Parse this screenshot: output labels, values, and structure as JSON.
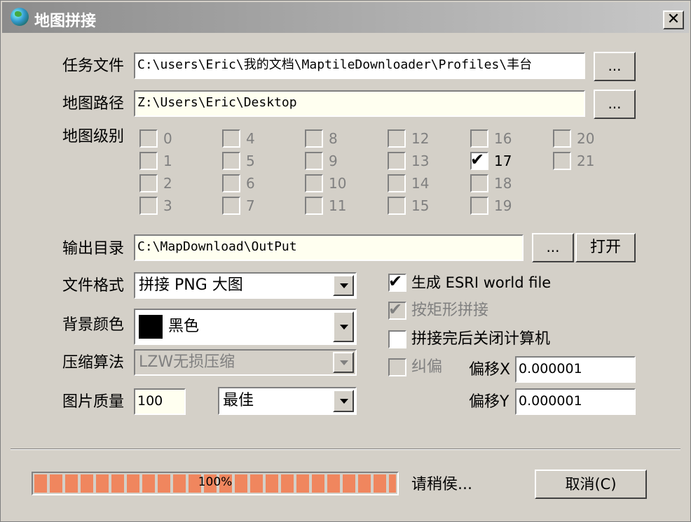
{
  "window": {
    "title": "地图拼接",
    "close_label": "✕"
  },
  "task_file": {
    "label": "任务文件",
    "value": "C:\\users\\Eric\\我的文档\\MaptileDownloader\\Profiles\\丰台",
    "browse_label": "..."
  },
  "map_path": {
    "label": "地图路径",
    "value": "Z:\\Users\\Eric\\Desktop",
    "browse_label": "..."
  },
  "levels": {
    "label": "地图级别",
    "items": [
      {
        "n": "0",
        "checked": false
      },
      {
        "n": "1",
        "checked": false
      },
      {
        "n": "2",
        "checked": false
      },
      {
        "n": "3",
        "checked": false
      },
      {
        "n": "4",
        "checked": false
      },
      {
        "n": "5",
        "checked": false
      },
      {
        "n": "6",
        "checked": false
      },
      {
        "n": "7",
        "checked": false
      },
      {
        "n": "8",
        "checked": false
      },
      {
        "n": "9",
        "checked": false
      },
      {
        "n": "10",
        "checked": false
      },
      {
        "n": "11",
        "checked": false
      },
      {
        "n": "12",
        "checked": false
      },
      {
        "n": "13",
        "checked": false
      },
      {
        "n": "14",
        "checked": false
      },
      {
        "n": "15",
        "checked": false
      },
      {
        "n": "16",
        "checked": false
      },
      {
        "n": "17",
        "checked": true
      },
      {
        "n": "18",
        "checked": false
      },
      {
        "n": "19",
        "checked": false
      },
      {
        "n": "20",
        "checked": false
      },
      {
        "n": "21",
        "checked": false
      }
    ]
  },
  "output_dir": {
    "label": "输出目录",
    "value": "C:\\MapDownload\\OutPut",
    "browse_label": "...",
    "open_label": "打开"
  },
  "file_format": {
    "label": "文件格式",
    "value": "拼接 PNG 大图"
  },
  "bg_color": {
    "label": "背景颜色",
    "value": "黑色",
    "swatch": "#000000"
  },
  "compression": {
    "label": "压缩算法",
    "value": "LZW无损压缩"
  },
  "quality": {
    "label": "图片质量",
    "value": "100",
    "preset": "最佳"
  },
  "options": {
    "esri_world_file": {
      "label": "生成 ESRI world file",
      "checked": true
    },
    "rect_stitch": {
      "label": "按矩形拼接",
      "checked": true
    },
    "shutdown": {
      "label": "拼接完后关闭计算机",
      "checked": false
    },
    "correction": {
      "label": "纠偏",
      "checked": false
    }
  },
  "offset_x": {
    "label": "偏移X",
    "value": "0.000001"
  },
  "offset_y": {
    "label": "偏移Y",
    "value": "0.000001"
  },
  "progress": {
    "percent": 100,
    "text": "100%",
    "status": "请稍侯...",
    "color": "#f0865e"
  },
  "cancel_label": "取消(C)"
}
